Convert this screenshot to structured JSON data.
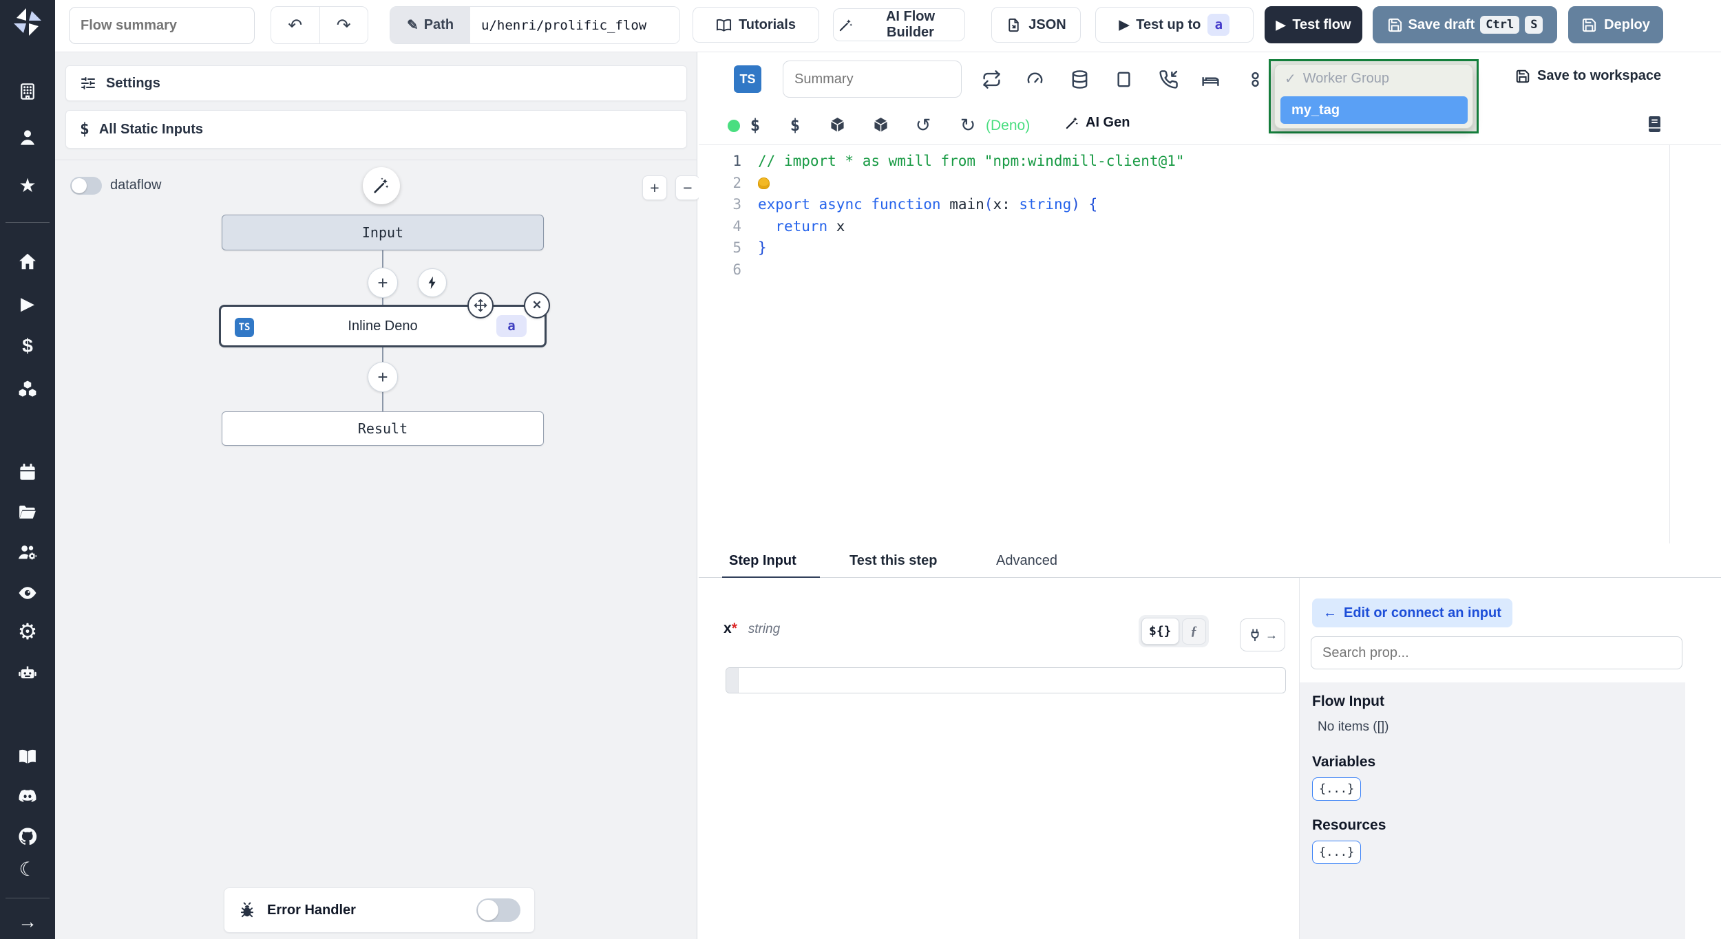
{
  "glyphs": {
    "star": "★",
    "play": "▶",
    "dollar": "$",
    "gear": "⚙",
    "moon": "☾",
    "arrow_right": "→",
    "undo": "↶",
    "redo": "↷",
    "pencil": "✎",
    "rotate_ccw": "↺",
    "rotate_cw": "↻",
    "close": "✕",
    "check": "✓",
    "plus": "+",
    "minus": "−",
    "arrow_left": "←"
  },
  "header": {
    "flow_summary_placeholder": "Flow summary",
    "path_label": "Path",
    "path_value": "u/henri/prolific_flow",
    "tutorials_label": "Tutorials",
    "ai_flow_builder_label": "AI Flow Builder",
    "json_label": "JSON",
    "test_up_to_label": "Test up to",
    "test_up_to_badge": "a",
    "test_flow_label": "Test flow",
    "save_draft_label": "Save draft",
    "kbd_ctrl": "Ctrl",
    "kbd_s": "S",
    "deploy_label": "Deploy"
  },
  "sidebar": {
    "icons": [
      "workspace-building",
      "user",
      "favorites-star",
      "home",
      "runs-play",
      "variables-dollar",
      "resources-boxes",
      "schedules-calendar",
      "folders",
      "groups",
      "audit-eye",
      "settings-gear",
      "ai-robot",
      "docs-book",
      "discord",
      "github",
      "dark-mode-moon",
      "collapse-arrow"
    ]
  },
  "left_panel": {
    "settings_label": "Settings",
    "static_inputs_label": "All Static Inputs",
    "static_inputs_icon": "$",
    "dataflow_label": "dataflow",
    "graph": {
      "input_label": "Input",
      "step_lang": "TS",
      "step_label": "Inline Deno",
      "step_badge": "a",
      "result_label": "Result"
    },
    "error_handler_label": "Error Handler"
  },
  "editor": {
    "lang_badge": "TS",
    "summary_placeholder": "Summary",
    "dollar_tool": "$",
    "lang_hint": "(Deno)",
    "ai_gen_label": "AI Gen",
    "save_to_workspace_label": "Save to workspace",
    "code": {
      "lines": [
        {
          "num": "1",
          "active": true,
          "tokens": [
            {
              "t": "// import * as wmill from \"npm:windmill-client@1\"",
              "c": "com"
            }
          ]
        },
        {
          "num": "2",
          "tokens": [
            {
              "icon": "lightbulb"
            }
          ]
        },
        {
          "num": "3",
          "tokens": [
            {
              "t": "export",
              "c": "kw"
            },
            {
              "t": " ",
              "c": "pl"
            },
            {
              "t": "async",
              "c": "kw"
            },
            {
              "t": " ",
              "c": "pl"
            },
            {
              "t": "function",
              "c": "kw"
            },
            {
              "t": " ",
              "c": "pl"
            },
            {
              "t": "main",
              "c": "fn"
            },
            {
              "t": "(",
              "c": "br"
            },
            {
              "t": "x",
              "c": "pl"
            },
            {
              "t": ": ",
              "c": "pl"
            },
            {
              "t": "string",
              "c": "ty"
            },
            {
              "t": ")",
              "c": "br"
            },
            {
              "t": " ",
              "c": "pl"
            },
            {
              "t": "{",
              "c": "br"
            }
          ]
        },
        {
          "num": "4",
          "tokens": [
            {
              "t": "  ",
              "c": "pl"
            },
            {
              "t": "return",
              "c": "kw"
            },
            {
              "t": " x",
              "c": "pl"
            }
          ]
        },
        {
          "num": "5",
          "tokens": [
            {
              "t": "}",
              "c": "br"
            }
          ]
        },
        {
          "num": "6",
          "tokens": []
        }
      ]
    }
  },
  "worker_dropdown": {
    "group_label": "Worker Group",
    "selected_tag": "my_tag"
  },
  "bottom": {
    "tabs": [
      {
        "label": "Step Input"
      },
      {
        "label": "Test this step"
      },
      {
        "label": "Advanced"
      }
    ],
    "field": {
      "name": "x",
      "required": "*",
      "type": "string"
    },
    "expr_toggle": "${}",
    "fx_toggle": "ƒ",
    "input_value": ""
  },
  "props": {
    "edit_connect_label": "Edit or connect an input",
    "search_placeholder": "Search prop...",
    "flow_input_title": "Flow Input",
    "flow_input_empty": "No items ([])",
    "variables_title": "Variables",
    "variables_value": "{...}",
    "resources_title": "Resources",
    "resources_value": "{...}"
  },
  "colors": {
    "accent_blue": "#3b82f6",
    "steel_button": "#64819e",
    "dark_button": "#242c3c",
    "sidebar_bg": "#222936",
    "green_border": "#15803d",
    "tag_highlight": "#5aa0f5",
    "deno_green": "#4ade80",
    "ts_blue": "#3178c6"
  }
}
